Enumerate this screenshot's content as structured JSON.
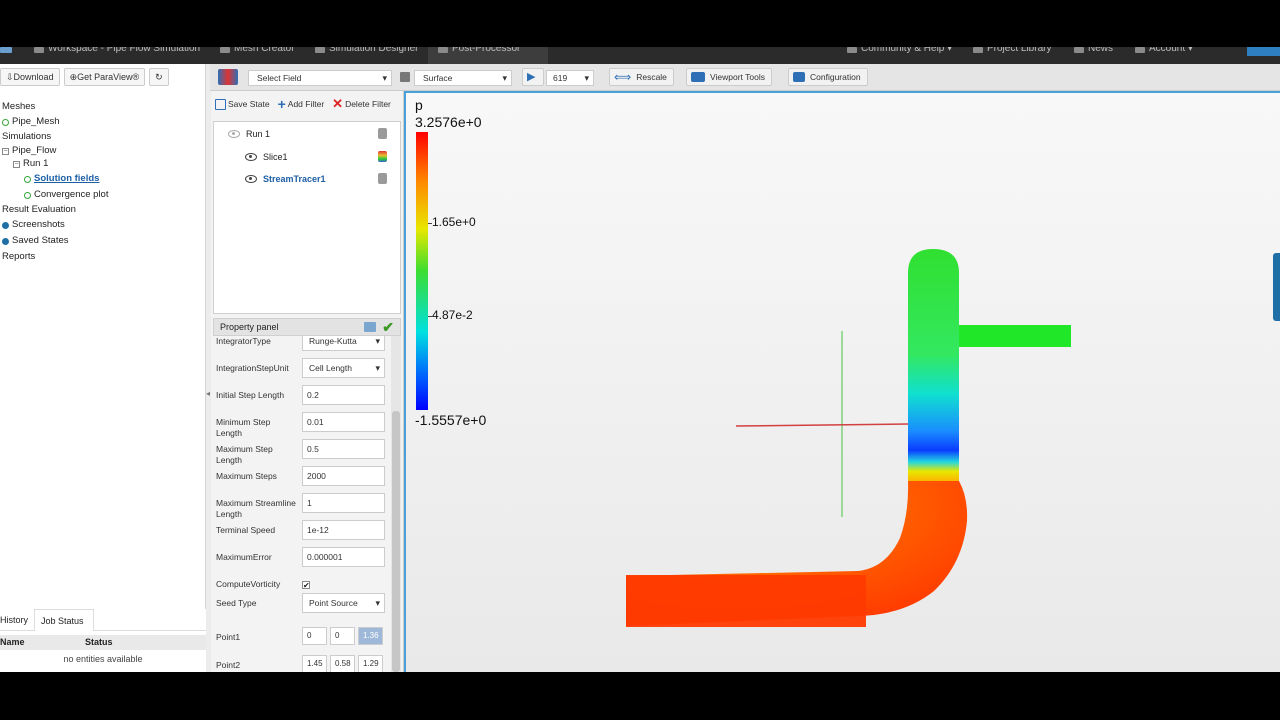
{
  "nav": {
    "items": [
      {
        "label": "Workspace - Pipe Flow Simulation"
      },
      {
        "label": "Mesh Creator"
      },
      {
        "label": "Simulation Designer"
      },
      {
        "label": "Post-Processor"
      },
      {
        "label": "Community & Help ▾"
      },
      {
        "label": "Project Library"
      },
      {
        "label": "News"
      },
      {
        "label": "Account ▾"
      }
    ],
    "active_index": 3
  },
  "tree_toolbar": {
    "download": "Download",
    "paraview": "Get ParaView®",
    "refresh_icon": "refresh-icon"
  },
  "tree": {
    "meshes": "Meshes",
    "pipe_mesh": "Pipe_Mesh",
    "simulations": "Simulations",
    "pipe_flow": "Pipe_Flow",
    "run1": "Run 1",
    "solution_fields": "Solution fields",
    "convergence_plot": "Convergence plot",
    "result_evaluation": "Result Evaluation",
    "screenshots": "Screenshots",
    "saved_states": "Saved States",
    "reports": "Reports"
  },
  "bottom_tabs": {
    "history": "History",
    "job_status": "Job Status",
    "col_name": "Name",
    "col_status": "Status",
    "empty": "no entities available"
  },
  "filter_toolbar": {
    "save_state": "Save State",
    "add_filter": "Add Filter",
    "delete_filter": "Delete Filter"
  },
  "pipeline": {
    "run": "Run 1",
    "slice": "Slice1",
    "stream_tracer": "StreamTracer1"
  },
  "property_panel": {
    "title": "Property panel",
    "integrator_type_label": "IntegratorType",
    "integrator_type": "Runge-Kutta",
    "step_unit_label": "IntegrationStepUnit",
    "step_unit": "Cell Length",
    "initial_step_label": "Initial Step Length",
    "initial_step": "0.2",
    "min_step_label": "Minimum Step Length",
    "min_step": "0.01",
    "max_step_label": "Maximum Step Length",
    "max_step": "0.5",
    "max_steps_label": "Maximum Steps",
    "max_steps": "2000",
    "max_streamline_label": "Maximum Streamline Length",
    "max_streamline": "1",
    "terminal_speed_label": "Terminal Speed",
    "terminal_speed": "1e-12",
    "max_error_label": "MaximumError",
    "max_error": "0.000001",
    "compute_vorticity_label": "ComputeVorticity",
    "compute_vorticity": "✔",
    "seed_type_label": "Seed Type",
    "seed_type": "Point Source",
    "point1_label": "Point1",
    "point1": [
      "0",
      "0",
      "1.36"
    ],
    "point2_label": "Point2",
    "point2": [
      "1.45",
      "0.58",
      "1.29"
    ]
  },
  "viewer_toolbar": {
    "field_select": "Select Field",
    "representation": "Surface",
    "frame": "619",
    "rescale": "Rescale",
    "viewport_tools": "Viewport Tools",
    "configuration": "Configuration"
  },
  "legend": {
    "variable": "p",
    "max": "3.2576e+0",
    "tick1": "1.65e+0",
    "tick2": "4.87e-2",
    "min": "-1.5557e+0"
  },
  "colors": {
    "accent": "#2e6fb5",
    "apply": "#3a9a22",
    "delete": "#d22222",
    "viewport_border": "#4aa0d8"
  }
}
